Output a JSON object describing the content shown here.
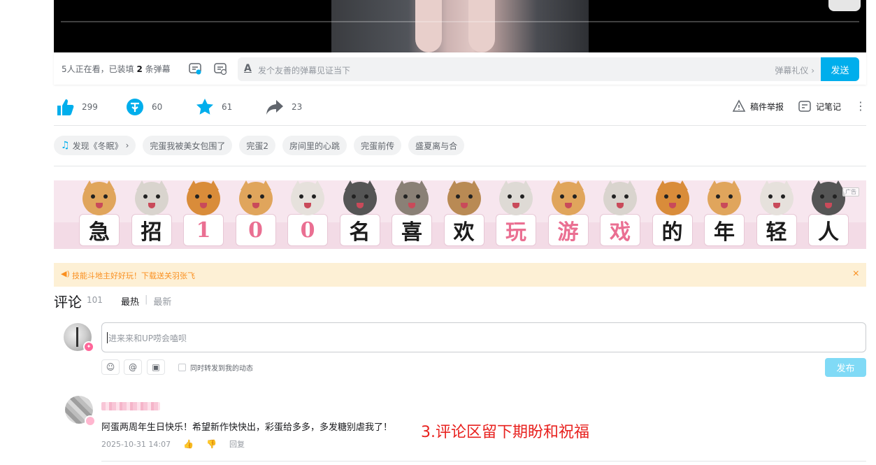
{
  "danmaku": {
    "viewers_prefix": "5人正在看，已装填 ",
    "count": "2",
    "viewers_suffix": " 条弹幕",
    "font_glyph": "A",
    "placeholder": "发个友善的弹幕见证当下",
    "etiquette": "弹幕礼仪 ›",
    "send": "发送"
  },
  "toolbar": {
    "like": "299",
    "coin": "60",
    "favorite": "61",
    "share": "23",
    "report": "稿件举报",
    "notes": "记笔记",
    "more_glyph": "⋮"
  },
  "tags": {
    "music": "发现《冬眠》",
    "music_arrow": "›",
    "items": [
      "完蛋我被美女包围了",
      "完蛋2",
      "房间里的心跳",
      "完蛋前传",
      "盛夏离与合"
    ]
  },
  "banner": {
    "chars": [
      "急",
      "招",
      "1",
      "0",
      "0",
      "名",
      "喜",
      "欢",
      "玩",
      "游",
      "戏",
      "的",
      "年",
      "轻",
      "人"
    ],
    "ad_label": "广告"
  },
  "notice": {
    "speaker_glyph": "◀)",
    "text": "技能斗地主好好玩！下载送关羽张飞",
    "close_glyph": "×"
  },
  "comments": {
    "title": "评论",
    "count": "101",
    "sort_hot": "最热",
    "sort_sep": "|",
    "sort_new": "最新",
    "input_placeholder": "进来来和UP唠会嗑呗",
    "repost_label": "同时转发到我的动态",
    "publish": "发布",
    "emoji_glyph": "☺",
    "at_glyph": "@",
    "image_glyph": "▣",
    "item": {
      "content": "阿蛋两周年生日快乐！希望新作快快出，彩蛋给多多，多发糖别虐我了！",
      "time": "2025-10-31 14:07",
      "like_glyph": "👍",
      "dislike_glyph": "👎",
      "reply": "回复"
    }
  },
  "annotation": "3.评论区留下期盼和祝福",
  "colors": {
    "accent": "#00aeec",
    "annotation": "#e8221f",
    "banner_pink": "#f7e6ee",
    "notice_bg": "#fdf0d5"
  }
}
